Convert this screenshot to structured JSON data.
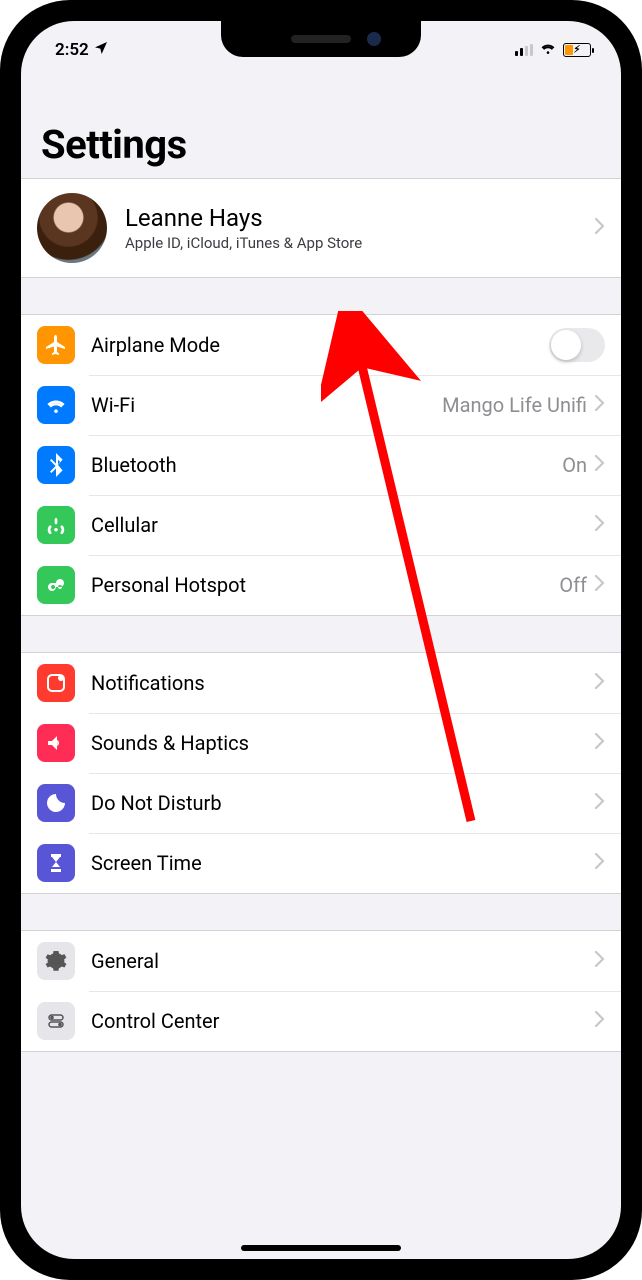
{
  "status": {
    "time": "2:52",
    "location_icon": "location"
  },
  "header": {
    "title": "Settings"
  },
  "profile": {
    "name": "Leanne Hays",
    "subtitle": "Apple ID, iCloud, iTunes & App Store"
  },
  "groups": [
    {
      "rows": [
        {
          "id": "airplane",
          "label": "Airplane Mode",
          "type": "toggle",
          "toggled": false
        },
        {
          "id": "wifi",
          "label": "Wi-Fi",
          "value": "Mango Life Unifi",
          "type": "link"
        },
        {
          "id": "bluetooth",
          "label": "Bluetooth",
          "value": "On",
          "type": "link"
        },
        {
          "id": "cellular",
          "label": "Cellular",
          "type": "link"
        },
        {
          "id": "hotspot",
          "label": "Personal Hotspot",
          "value": "Off",
          "type": "link"
        }
      ]
    },
    {
      "rows": [
        {
          "id": "notifications",
          "label": "Notifications",
          "type": "link"
        },
        {
          "id": "sounds",
          "label": "Sounds & Haptics",
          "type": "link"
        },
        {
          "id": "dnd",
          "label": "Do Not Disturb",
          "type": "link"
        },
        {
          "id": "screentime",
          "label": "Screen Time",
          "type": "link"
        }
      ]
    },
    {
      "rows": [
        {
          "id": "general",
          "label": "General",
          "type": "link"
        },
        {
          "id": "controlcenter",
          "label": "Control Center",
          "type": "link"
        }
      ]
    }
  ]
}
